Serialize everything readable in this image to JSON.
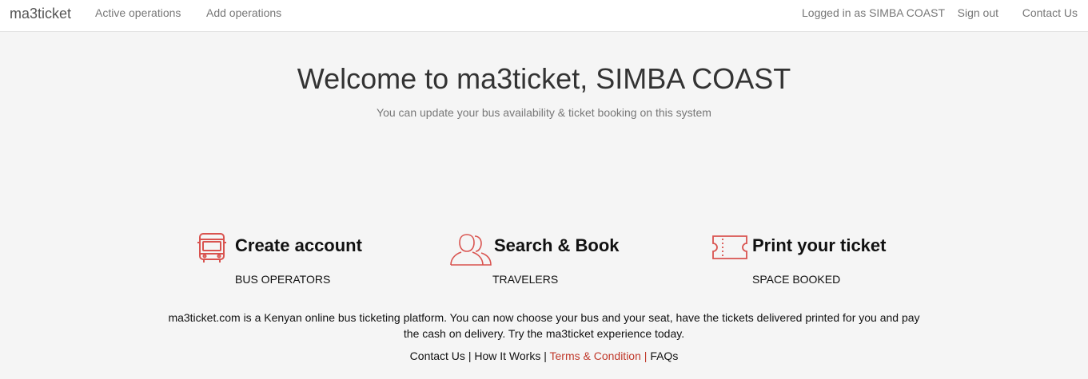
{
  "navbar": {
    "brand": "ma3ticket",
    "active_operations": "Active operations",
    "add_operations": "Add operations",
    "logged_in": "Logged in as SIMBA COAST",
    "sign_out": "Sign out",
    "contact_us": "Contact Us"
  },
  "hero": {
    "title": "Welcome to ma3ticket, SIMBA COAST",
    "subtitle": "You can update your bus availability & ticket booking on this system"
  },
  "features": [
    {
      "icon": "bus-icon",
      "title": "Create account",
      "subtitle": "BUS OPERATORS"
    },
    {
      "icon": "users-icon",
      "title": "Search & Book",
      "subtitle": "TRAVELERS"
    },
    {
      "icon": "ticket-icon",
      "title": "Print your ticket",
      "subtitle": "SPACE BOOKED"
    }
  ],
  "about": "ma3ticket.com is a Kenyan online bus ticketing platform. You can now choose your bus and your seat, have the tickets delivered printed for you and pay the cash on delivery. Try the ma3ticket experience today.",
  "footer": {
    "contact_us": "Contact Us",
    "how_it_works": "How It Works",
    "terms": "Terms & Condition",
    "faqs": "FAQs",
    "separator": "|"
  },
  "colors": {
    "accent": "#d9534f",
    "background": "#f5f5f5"
  }
}
